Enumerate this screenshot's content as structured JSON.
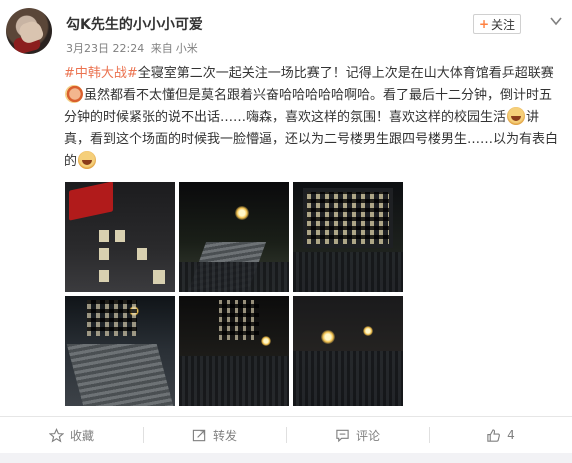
{
  "post": {
    "author": "勾K先生的小小小可爱",
    "date": "3月23日 22:24",
    "source_prefix": "来自",
    "source": "小米",
    "follow_label": "关注",
    "follow_plus": "+",
    "content": {
      "tag": "#中韩大战#",
      "part1": "全寝室第二次一起关注一场比赛了！记得上次是在山大体育馆看乒超联赛",
      "part2": "虽然都看不太懂但是莫名跟着兴奋哈哈哈哈哈啊哈。看了最后十二分钟，倒计时五分钟的时候紧张的说不出话……嗨森，喜欢这样的氛围！喜欢这样的校园生活",
      "part3": "讲真，看到这个场面的时候我一脸懵逼，还以为二号楼男生跟四号楼男生……以为有表白的"
    },
    "emojis": [
      "facepalm-emoji",
      "laughing-tears-emoji",
      "laughing-tears-emoji"
    ]
  },
  "photos": [
    {
      "name": "photo-red-flag-building"
    },
    {
      "name": "photo-stairs-streetlight"
    },
    {
      "name": "photo-dorm-windows-crowd"
    },
    {
      "name": "photo-crowd-stairs"
    },
    {
      "name": "photo-crowd-street-night"
    },
    {
      "name": "photo-crowd-dark-lights"
    }
  ],
  "actions": {
    "favorite": "收藏",
    "repost": "转发",
    "comment": "评论",
    "like_count": "4"
  },
  "colors": {
    "tag": "#eb7350",
    "follow_plus": "#ff8140",
    "meta": "#808080"
  }
}
